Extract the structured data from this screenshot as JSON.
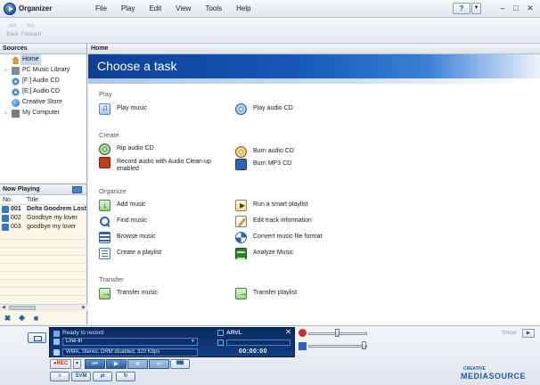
{
  "app": {
    "title": "Organizer"
  },
  "menu": [
    "File",
    "Play",
    "Edit",
    "View",
    "Tools",
    "Help"
  ],
  "help": {
    "label": "?",
    "dropdown": "▼"
  },
  "window_controls": {
    "minimize": "–",
    "maximize": "□",
    "close": "✕"
  },
  "toolbar": {
    "back": "Back",
    "forward": "Forward"
  },
  "sources": {
    "header": "Sources",
    "items": [
      {
        "label": "Home",
        "icon": "home-icon",
        "expander": ""
      },
      {
        "label": "PC Music Library",
        "icon": "pc-music-icon",
        "expander": "▷"
      },
      {
        "label": "[F:] Audio CD",
        "icon": "cd-icon",
        "expander": ""
      },
      {
        "label": "[E:] Audio CD",
        "icon": "cd-icon",
        "expander": ""
      },
      {
        "label": "Creative Store",
        "icon": "store-icon",
        "expander": ""
      },
      {
        "label": "My Computer",
        "icon": "computer-icon",
        "expander": "▷"
      }
    ]
  },
  "now_playing": {
    "header": "Now Playing",
    "columns": {
      "no": "No.",
      "title": "Title"
    },
    "tracks": [
      {
        "no": "001",
        "title": "Delta Goodrem Lost without you"
      },
      {
        "no": "002",
        "title": "Goodbye my lover"
      },
      {
        "no": "003",
        "title": "goodbye my lover"
      }
    ]
  },
  "breadcrumb": "Home",
  "main": {
    "banner_title": "Choose a task",
    "sections": {
      "play": "Play",
      "create": "Create",
      "organize": "Organize",
      "transfer": "Transfer"
    },
    "tasks": {
      "play_music": "Play music",
      "play_audio_cd": "Play audio CD",
      "rip_audio_cd": "Rip audio CD",
      "record_audio_line1": "Record audio with Audio Clean-up",
      "record_audio_line2": "enabled",
      "burn_audio_cd": "Burn audio CD",
      "burn_mp3_cd": "Burn MP3 CD",
      "add_music": "Add music",
      "run_smart_playlist": "Run a smart playlist",
      "find_music": "Find music",
      "edit_track_info": "Edit track information",
      "browse_music": "Browse music",
      "convert_music": "Convert music file format",
      "create_playlist": "Create a playlist",
      "analyze_music": "Analyze Music",
      "transfer_music": "Transfer music",
      "transfer_playlist": "Transfer playlist"
    }
  },
  "recorder": {
    "status": "Ready to record",
    "source": "Line-In",
    "format": "WMA, Stereo, DRM disabled, 320 Kbps",
    "arvl": "ARVL",
    "time": "00:00:00",
    "rec_label": "REC",
    "svm_label": "SVM",
    "show_label": "Show"
  },
  "brand": {
    "top": "CREATIVE",
    "name": "MEDIASOURCE"
  },
  "colors": {
    "banner": "#1457b8",
    "accent": "#2d63b0",
    "lcd": "#0a2a5e"
  }
}
